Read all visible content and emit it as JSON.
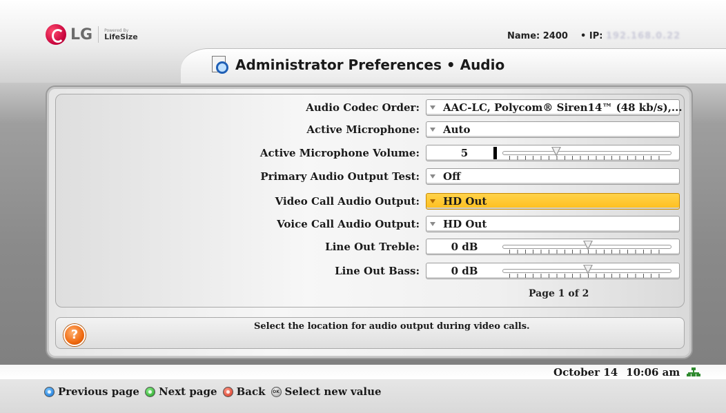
{
  "brand": {
    "logo": "LG",
    "powered_by": "Powered By",
    "partner": "LifeSize"
  },
  "header": {
    "name_label": "Name: 2400",
    "ip_label": "• IP:",
    "ip_value": "192.168.0.22",
    "title": "Administrator Preferences • Audio",
    "title_icon": "document-search-icon"
  },
  "settings": [
    {
      "label": "Audio Codec Order:",
      "type": "select",
      "value": "AAC-LC, Polycom® Siren14™ (48 kb/s),..."
    },
    {
      "label": "Active Microphone:",
      "type": "select",
      "value": "Auto"
    },
    {
      "label": "Active Microphone Volume:",
      "type": "slider",
      "value": "5",
      "level_fraction": 0.3
    },
    {
      "label": "Primary Audio Output Test:",
      "type": "select",
      "value": "Off"
    },
    {
      "label": "Video Call Audio Output:",
      "type": "select",
      "value": "HD Out",
      "selected": true
    },
    {
      "label": "Voice Call Audio Output:",
      "type": "select",
      "value": "HD Out"
    },
    {
      "label": "Line Out Treble:",
      "type": "slider",
      "value": "0 dB",
      "level_fraction": 0.5
    },
    {
      "label": "Line Out Bass:",
      "type": "slider",
      "value": "0 dB",
      "level_fraction": 0.5
    }
  ],
  "page_indicator": "Page 1 of 2",
  "help": {
    "icon": "question-icon",
    "text": "Select the location for audio output during video calls."
  },
  "status": {
    "date": "October 14",
    "time": "10:06 am",
    "network_icon": "network-icon"
  },
  "footer": {
    "hints": [
      {
        "color": "blue",
        "label": "Previous page"
      },
      {
        "color": "green",
        "label": "Next page"
      },
      {
        "color": "red",
        "label": "Back"
      },
      {
        "color": "ok",
        "label": "Select new value",
        "button_text": "OK"
      }
    ]
  },
  "colors": {
    "selected_field": "#ffc21f",
    "help_icon": "#f06a10"
  }
}
